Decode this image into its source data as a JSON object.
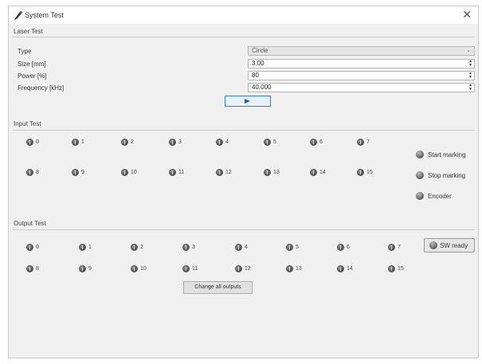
{
  "window": {
    "title": "System Test"
  },
  "laser_test": {
    "label": "Laser Test",
    "rows": [
      {
        "label": "Type",
        "value": "Circle"
      },
      {
        "label": "Size [mm]",
        "value": "3.00"
      },
      {
        "label": "Power [%]",
        "value": "80"
      },
      {
        "label": "Frequency [kHz]",
        "value": "40.000"
      }
    ]
  },
  "input_test": {
    "label": "Input Test",
    "row1": [
      "0",
      "1",
      "2",
      "3",
      "4",
      "5",
      "6",
      "7"
    ],
    "row2": [
      "8",
      "9",
      "10",
      "11",
      "12",
      "13",
      "14",
      "15"
    ],
    "status": [
      "Start marking",
      "Stop marking",
      "Encoder"
    ]
  },
  "output_test": {
    "label": "Output Test",
    "row1": [
      "0",
      "1",
      "2",
      "3",
      "4",
      "5",
      "6",
      "7"
    ],
    "row2": [
      "8",
      "9",
      "10",
      "11",
      "12",
      "13",
      "14",
      "15"
    ],
    "sw_ready": "SW ready",
    "change_all": "Change all outputs"
  }
}
